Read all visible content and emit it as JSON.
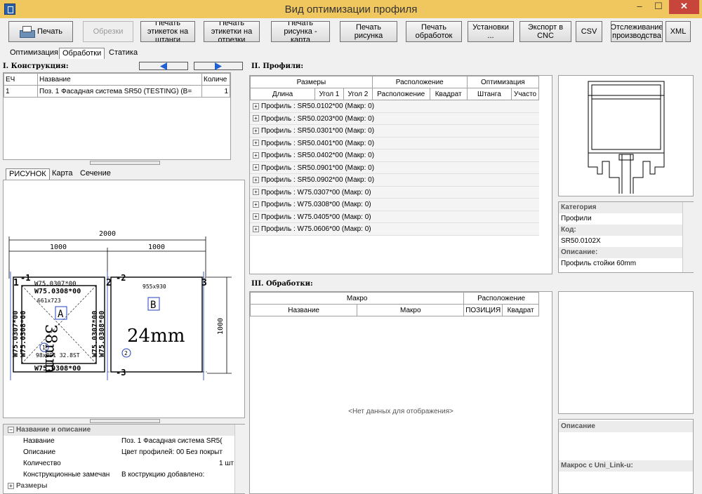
{
  "window": {
    "title": "Вид оптимизации профиля",
    "min": "–",
    "max": "☐",
    "close": "✕"
  },
  "toolbar": {
    "print": "Печать",
    "trims": "Обрезки",
    "print_labels_bars": "Печать этикеток на штанги",
    "print_labels_cuts": "Печать этикетки на отрезки",
    "print_drawing_map": "Печать рисунка - карта",
    "print_drawing": "Печать рисунка",
    "print_machining": "Печать обработок",
    "settings": "Установки ...",
    "export_cnc": "Экспорт в CNC",
    "csv": "CSV",
    "tracking": "Отслеживание производства",
    "xml": "XML"
  },
  "tabs": [
    "Оптимизация",
    "Обработки",
    "Статика"
  ],
  "construction": {
    "title": "I. Конструкция:",
    "headers": [
      "ЕЧ",
      "Название",
      "Количе"
    ],
    "rows": [
      {
        "ech": "1",
        "name": "Поз.  1 Фасадная система SR50 (TESTING) (В=",
        "qty": "1"
      }
    ]
  },
  "drawing_tabs": [
    "РИСУНОК",
    "Карта",
    "Сечение"
  ],
  "drawing": {
    "dim_total": "2000",
    "dim_left": "1000",
    "dim_right": "1000",
    "dim_height": "1000",
    "lbl_1": "1",
    "lbl_2": "2",
    "lbl_3": "3",
    "lbl_m1": "-1",
    "lbl_m2": "-2",
    "lbl_m3": "-3",
    "prof_top": "W75.0307*00",
    "prof_top2": "W75.0308*00",
    "prof_bottom": "W75.0308*00",
    "prof_left1": "W75.0307*00",
    "prof_left2": "W75.0308*00",
    "prof_mid1": "W75.0307*00",
    "prof_mid2": "W75.0308*00",
    "size_a": "661x723",
    "size_b": "955x930",
    "panel_a": "A",
    "panel_b": "B",
    "glass_a": "38mm",
    "glass_b": "24mm",
    "circle_1": "1",
    "circle_2": "2",
    "glass_code": "98x891 32.8ST"
  },
  "properties": {
    "group1": "Название и описание",
    "rows": [
      {
        "k": "Название",
        "v": "Поз.  1 Фасадная система SR5("
      },
      {
        "k": "Описание",
        "v": "Цвет профилей: 00 Без покрыт"
      },
      {
        "k": "Количество",
        "v": "1 шт"
      },
      {
        "k": "Конструкционные замечан",
        "v": "В кострукцию добавлено:"
      }
    ],
    "group2": "Размеры"
  },
  "profiles": {
    "title": "II. Профили:",
    "group_headers": [
      "Размеры",
      "Расположение",
      "Оптимизация"
    ],
    "headers": [
      "Длина",
      "Угол 1",
      "Угол 2",
      "Расположение",
      "Квадрат",
      "Штанга",
      "Участо"
    ],
    "rows": [
      "Профиль : SR50.0102*00 (Макр:  0)",
      "Профиль : SR50.0203*00 (Макр:  0)",
      "Профиль : SR50.0301*00 (Макр:  0)",
      "Профиль : SR50.0401*00 (Макр:  0)",
      "Профиль : SR50.0402*00 (Макр:  0)",
      "Профиль : SR50.0901*00 (Макр:  0)",
      "Профиль : SR50.0902*00 (Макр:  0)",
      "Профиль : W75.0307*00 (Макр:  0)",
      "Профиль : W75.0308*00 (Макр:  0)",
      "Профиль : W75.0405*00 (Макр:  0)",
      "Профиль : W75.0606*00 (Макр:  0)"
    ]
  },
  "machining": {
    "title": "III. Обработки:",
    "group_headers": [
      "Макро",
      "Расположение"
    ],
    "headers": [
      "Название",
      "Макро",
      "ПОЗИЦИЯ",
      "Квадрат"
    ],
    "empty": "<Нет данных для отображения>"
  },
  "info": {
    "category_label": "Категория",
    "category": "Профили",
    "code_label": "Код:",
    "code": "SR50.0102X",
    "desc_label": "Описание:",
    "desc": "Профиль стойки 60mm"
  },
  "details": {
    "desc_label": "Описание",
    "macros_label": "Макрос с Uni_Link-u:"
  }
}
